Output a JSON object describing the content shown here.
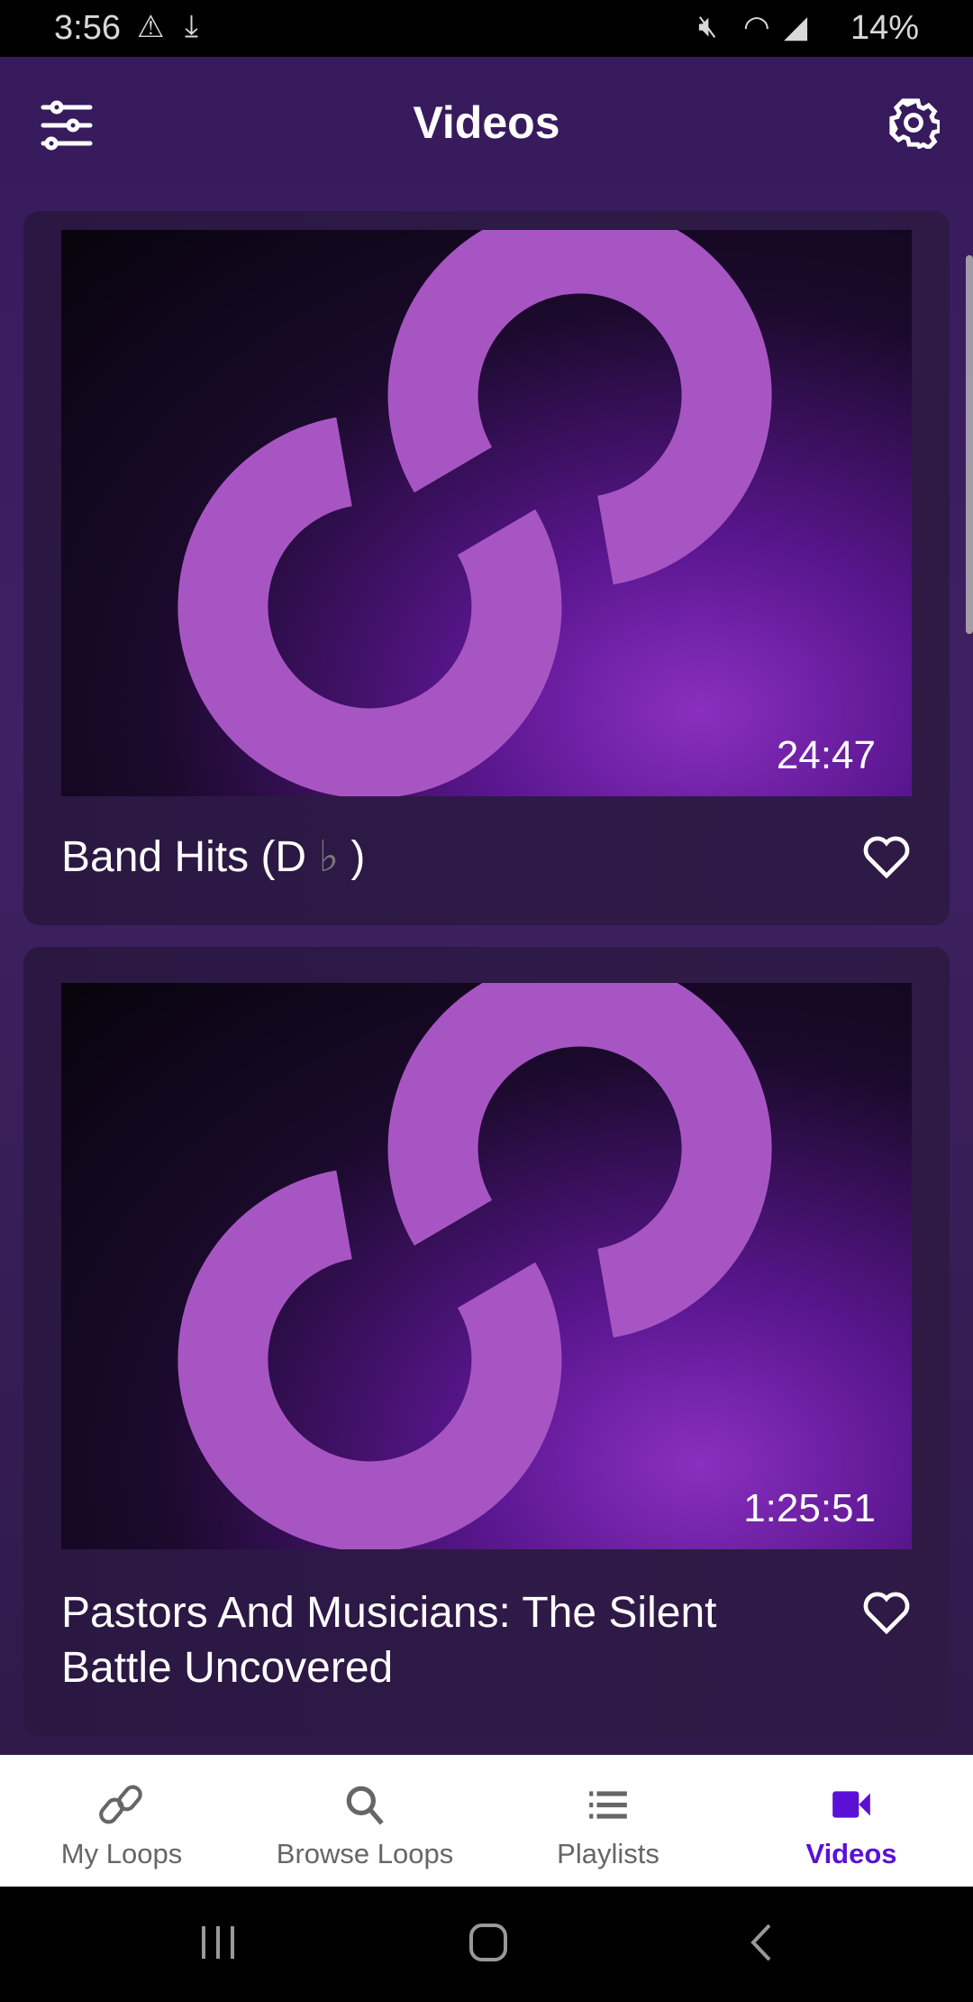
{
  "status_bar": {
    "time": "3:56",
    "battery": "14%"
  },
  "app_bar": {
    "title": "Videos",
    "filter_icon": "sliders-icon",
    "settings_icon": "gear-icon"
  },
  "videos": [
    {
      "title": "Band Hits (D",
      "title_flat": "♭",
      "title_end": " )",
      "duration": "24:47",
      "favorite": false
    },
    {
      "title": "Pastors And Musicians: The Silent Battle Uncovered",
      "duration": "1:25:51",
      "favorite": false
    }
  ],
  "bottom_nav": {
    "active": "Videos",
    "active_color": "#5b10d6",
    "items": [
      {
        "label": "My Loops",
        "icon": "link-icon"
      },
      {
        "label": "Browse Loops",
        "icon": "search-icon"
      },
      {
        "label": "Playlists",
        "icon": "list-icon"
      },
      {
        "label": "Videos",
        "icon": "video-camera-icon"
      }
    ]
  }
}
